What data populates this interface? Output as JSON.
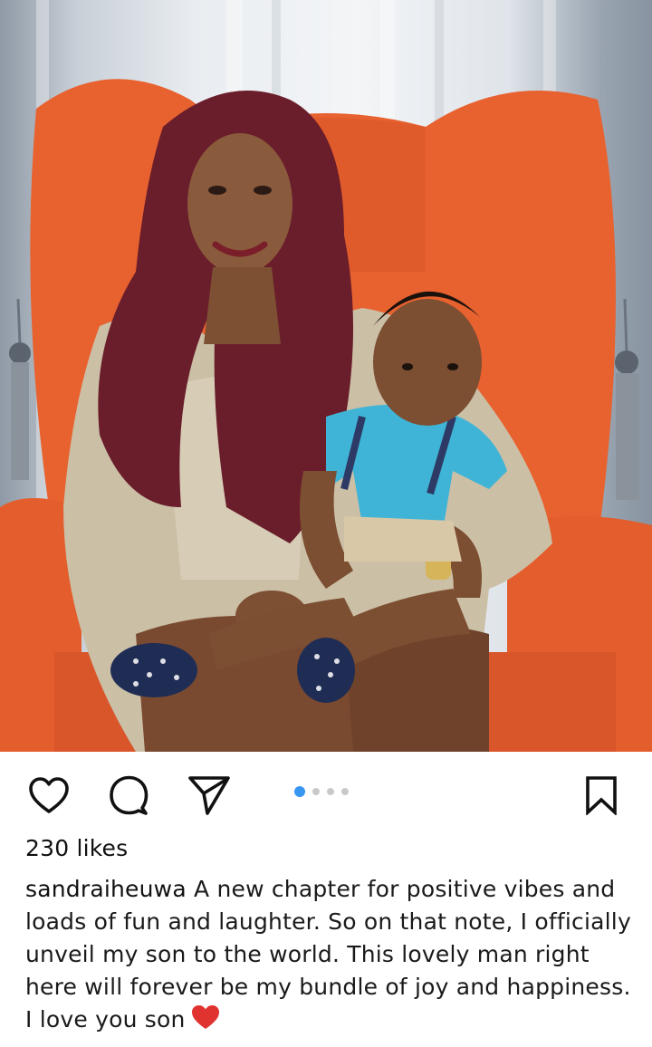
{
  "post": {
    "likes_text": "230 likes",
    "username": "sandraiheuwa",
    "caption_lines": [
      " A new chapter for positive vibes and",
      "loads of fun and laughter. So on that note, I officially",
      "unveil my son to the world. This lovely man right",
      "here will forever be my bundle of joy and happiness.",
      "I love you son"
    ],
    "caption_emoji": "red-heart-emoji",
    "carousel": {
      "count": 4,
      "active_index": 0
    },
    "icons": {
      "like": "heart-outline-icon",
      "comment": "comment-bubble-icon",
      "share": "paper-plane-icon",
      "save": "bookmark-outline-icon"
    },
    "colors": {
      "accent_dot": "#3897f0",
      "heart_emoji": "#e0322e",
      "chair": "#e8622f"
    }
  }
}
